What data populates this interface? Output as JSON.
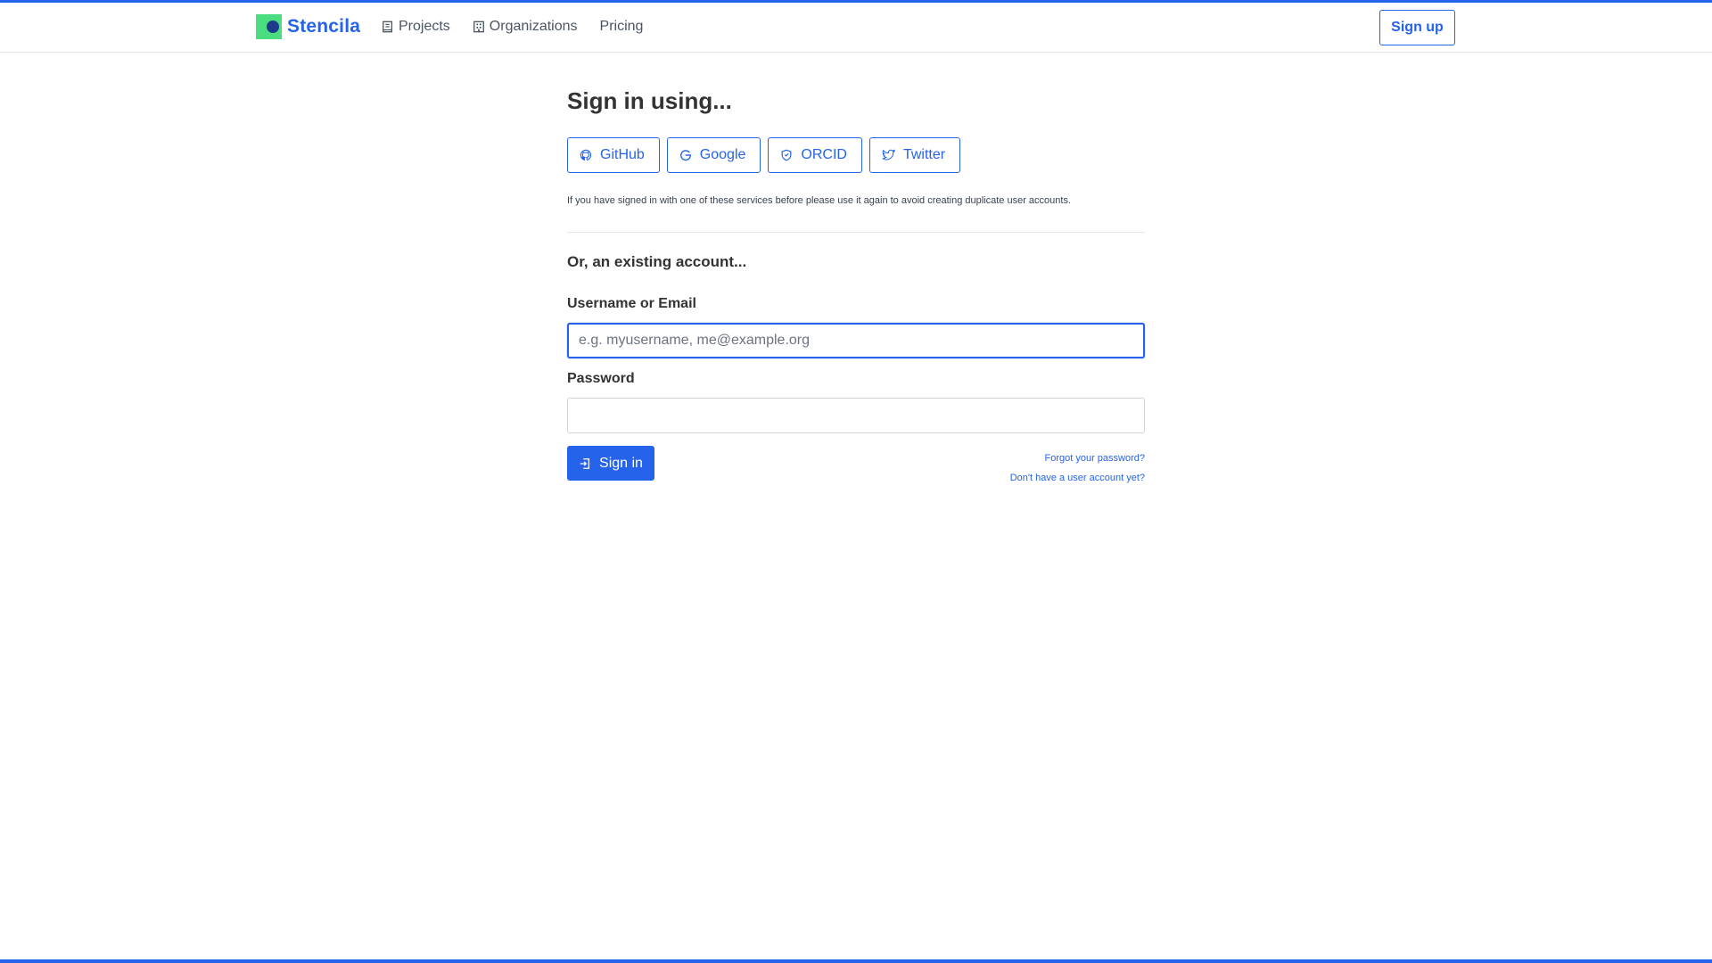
{
  "header": {
    "logo_text": "Stencila",
    "nav": [
      {
        "label": "Projects",
        "icon": "book-icon"
      },
      {
        "label": "Organizations",
        "icon": "building-icon"
      },
      {
        "label": "Pricing",
        "icon": ""
      }
    ],
    "signup_label": "Sign up"
  },
  "main": {
    "title": "Sign in using...",
    "providers": [
      {
        "label": "GitHub",
        "icon": "github-icon"
      },
      {
        "label": "Google",
        "icon": "google-icon"
      },
      {
        "label": "ORCID",
        "icon": "orcid-shield-icon"
      },
      {
        "label": "Twitter",
        "icon": "twitter-icon"
      }
    ],
    "note": "If you have signed in with one of these services before please use it again to avoid creating duplicate user accounts.",
    "subtitle": "Or, an existing account...",
    "username_label": "Username or Email",
    "username_placeholder": "e.g. myusername, me@example.org",
    "username_value": "",
    "password_label": "Password",
    "password_value": "",
    "signin_label": "Sign in",
    "forgot_label": "Forgot your password?",
    "no_account_label": "Don't have a user account yet?"
  },
  "colors": {
    "accent": "#2563eb",
    "logo_green": "#4ade80",
    "logo_dot": "#1e3a8a"
  }
}
